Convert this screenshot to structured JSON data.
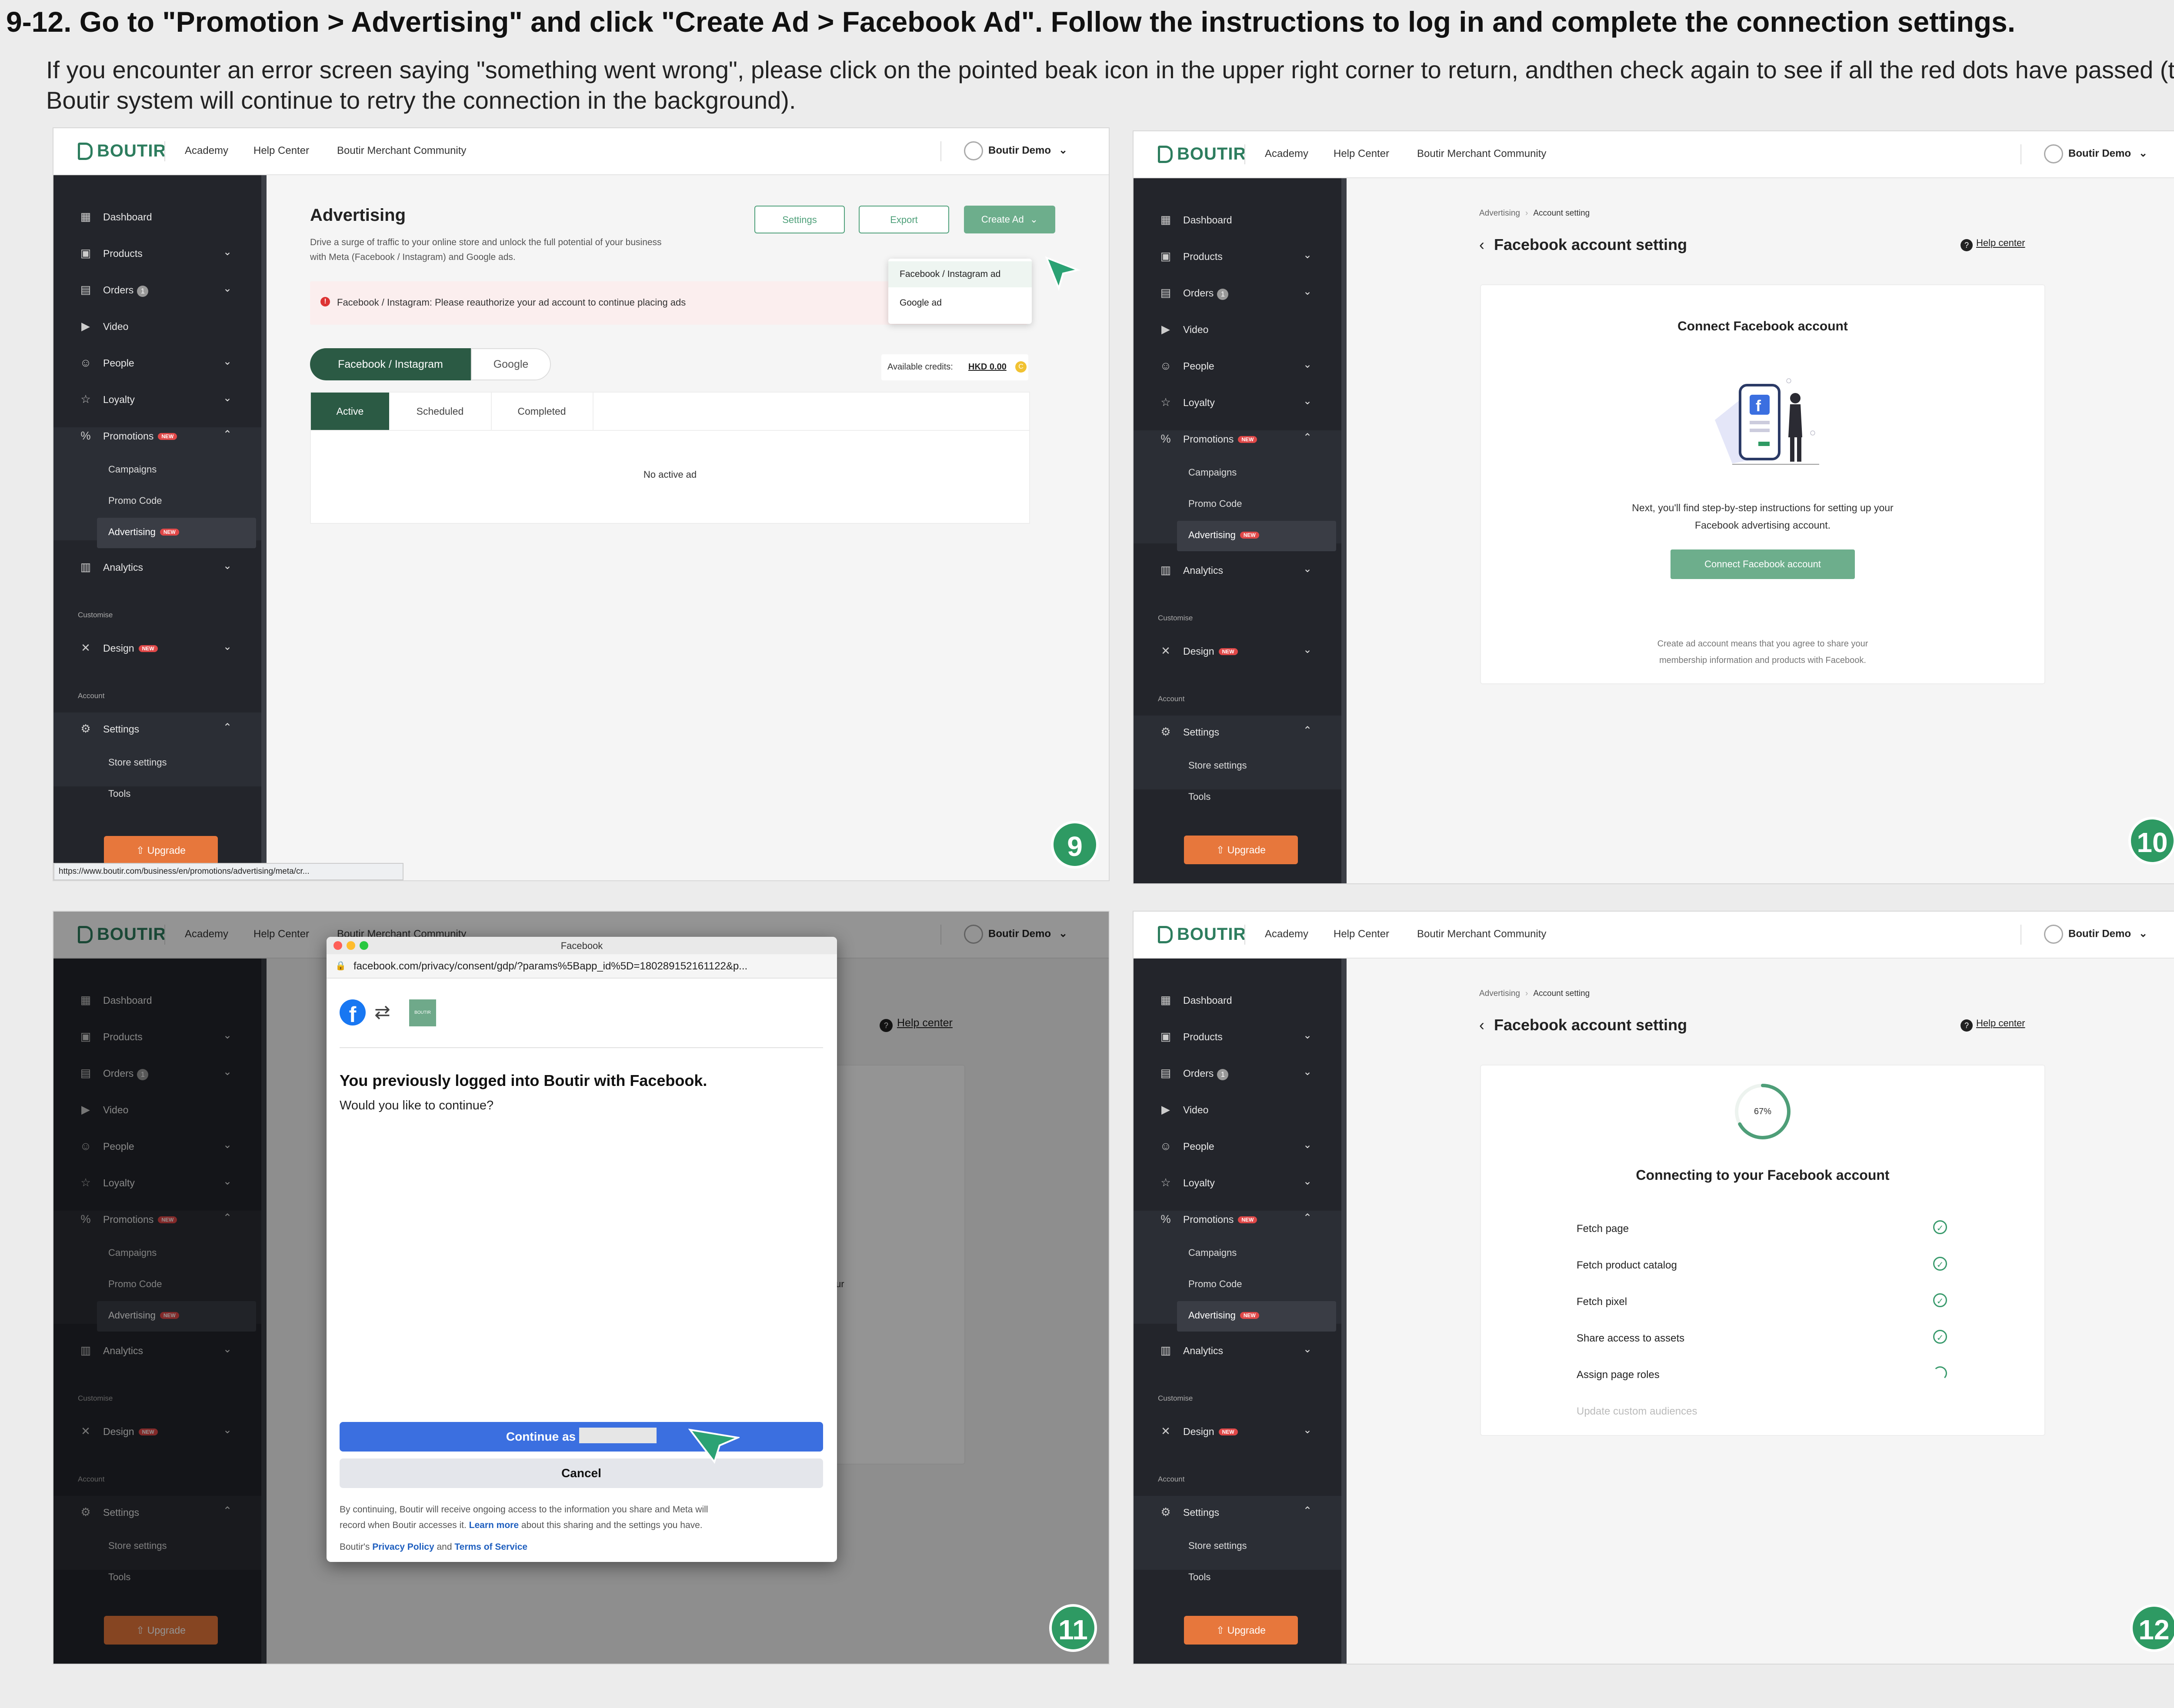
{
  "headline": "9-12. Go to \"Promotion > Advertising\" and click \"Create Ad > Facebook Ad\". Follow the instructions to log in and complete the connection settings.",
  "intro": "If you encounter an error screen saying \"something went wrong\", please click on the pointed beak icon in the upper right corner to return, andthen check again to see if all the red dots have passed (the Boutir system will continue to retry the connection in the background).",
  "app": {
    "logo": "BOUTIR",
    "top_links": [
      "Academy",
      "Help Center",
      "Boutir Merchant Community"
    ],
    "user": "Boutir Demo",
    "sidebar": {
      "dashboard": "Dashboard",
      "products": "Products",
      "orders": "Orders",
      "orders_count": "1",
      "video": "Video",
      "people": "People",
      "loyalty": "Loyalty",
      "promotions": "Promotions",
      "new": "NEW",
      "campaigns": "Campaigns",
      "promo_code": "Promo Code",
      "advertising": "Advertising",
      "analytics": "Analytics",
      "customise": "Customise",
      "design": "Design",
      "account": "Account",
      "settings": "Settings",
      "store_settings": "Store settings",
      "tools": "Tools",
      "upgrade": "Upgrade"
    },
    "breadcrumb_parent": "Advertising",
    "breadcrumb_current": "Account setting",
    "fb_page_title": "Facebook account setting",
    "help_center": "Help center"
  },
  "step9": {
    "badge": "9",
    "title": "Advertising",
    "desc1": "Drive a surge of traffic to your online store and unlock the full potential of your business",
    "desc2": "with Meta (Facebook / Instagram) and Google ads.",
    "settings_btn": "Settings",
    "export_btn": "Export",
    "create_btn": "Create Ad",
    "menu": [
      "Facebook / Instagram ad",
      "Google ad"
    ],
    "alert": "Facebook / Instagram: Please reauthorize your ad account to continue placing ads",
    "tab_fb": "Facebook / Instagram",
    "tab_google": "Google",
    "credits_label": "Available credits:",
    "credits_value": "HKD 0.00",
    "subtabs": [
      "Active",
      "Scheduled",
      "Completed"
    ],
    "empty": "No active ad",
    "status_url": "https://www.boutir.com/business/en/promotions/advertising/meta/cr..."
  },
  "step10": {
    "badge": "10",
    "card_title": "Connect Facebook account",
    "desc1": "Next, you'll find step-by-step instructions for setting up your",
    "desc2": "Facebook advertising account.",
    "button": "Connect Facebook account",
    "note1": "Create ad account means that you agree to share your",
    "note2": "membership information and products with Facebook."
  },
  "step11": {
    "badge": "11",
    "window_title": "Facebook",
    "url": "facebook.com/privacy/consent/gdp/?params%5Bapp_id%5D=180289152161122&p...",
    "brand_mini": "BOUTIR",
    "heading": "You previously logged into Boutir with Facebook.",
    "question": "Would you like to continue?",
    "continue_label": "Continue as",
    "cancel_label": "Cancel",
    "disclaimer1": "By continuing, Boutir will receive ongoing access to the information you share and Meta will",
    "disclaimer2a": "record when Boutir accesses it.",
    "learn_more": "Learn more",
    "disclaimer2b": "about this sharing and the settings you have.",
    "policy_prefix": "Boutir's",
    "privacy_policy": "Privacy Policy",
    "and": "and",
    "terms": "Terms of Service",
    "bg_fragment": "ur"
  },
  "step12": {
    "badge": "12",
    "progress": 0.67,
    "progress_label": "67%",
    "heading": "Connecting to your Facebook account",
    "tasks": [
      {
        "label": "Fetch page",
        "status": "done"
      },
      {
        "label": "Fetch product catalog",
        "status": "done"
      },
      {
        "label": "Fetch pixel",
        "status": "done"
      },
      {
        "label": "Share access to assets",
        "status": "done"
      },
      {
        "label": "Assign page roles",
        "status": "loading"
      },
      {
        "label": "Update custom audiences",
        "status": "pending"
      }
    ]
  },
  "colors": {
    "brand_green": "#2d7d5e",
    "facebook_blue": "#3b6fe0",
    "upgrade_orange": "#e7773c",
    "badge_green": "#2e9a63"
  }
}
